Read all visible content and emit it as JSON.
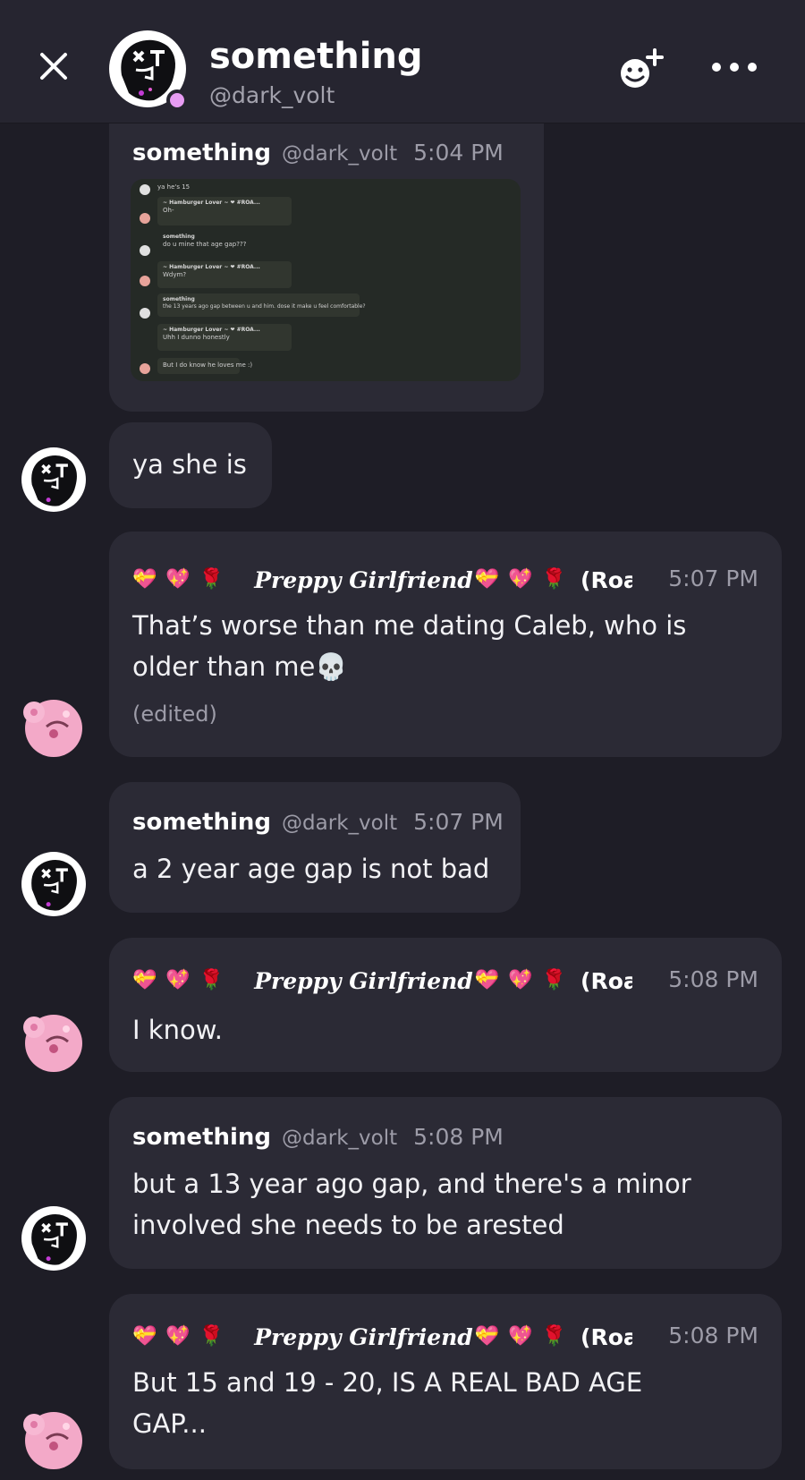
{
  "header": {
    "title": "something",
    "handle": "@dark_volt"
  },
  "colors": {
    "background": "#1e1d26",
    "bubble": "#2b2a35",
    "header": "#262530",
    "status_dot": "#e79cf3",
    "muted_text": "#9d9ca8"
  },
  "icons": {
    "close": "close-icon",
    "add_friend": "add-friend-icon",
    "more": "more-icon"
  },
  "screenshot_message": {
    "name": "something",
    "handle": "@dark_volt",
    "time": "5:04 PM",
    "image_lines": [
      "ya he's 15",
      "~ Hamburger Lover ~ ❤ #ROA...",
      "Oh-",
      "something",
      "do u mine that age gap???",
      "~ Hamburger Lover ~ ❤ #ROA...",
      "Wdym?",
      "something",
      "the 13 years ago gap between u and him. dose it make u feel comfortable?",
      "~ Hamburger Lover ~ ❤ #ROA...",
      "Uhh I dunno honestly",
      "But I do know he loves me :)"
    ]
  },
  "messages": [
    {
      "text": "ya she is"
    },
    {
      "name": "Preppy Girlfriend",
      "tail": "(Roa",
      "time": "5:07 PM",
      "text_line1": "That’s worse than me dating Caleb, who is",
      "text_line2": "older than me💀",
      "edited": "(edited)"
    },
    {
      "name": "something",
      "handle": "@dark_volt",
      "time": "5:07 PM",
      "text": "a 2 year age gap is not bad"
    },
    {
      "name": "Preppy Girlfriend",
      "tail": "(Roa",
      "time": "5:08 PM",
      "text": "I know."
    },
    {
      "name": "something",
      "handle": "@dark_volt",
      "time": "5:08 PM",
      "text_line1": "but a 13 year ago gap, and there's a minor",
      "text_line2": "involved she needs to be arested"
    },
    {
      "name": "Preppy Girlfriend",
      "tail": "(Roa",
      "time": "5:08 PM",
      "text_line1": "But 15 and 19 - 20, IS A REAL BAD AGE",
      "text_line2": "GAP..."
    }
  ]
}
